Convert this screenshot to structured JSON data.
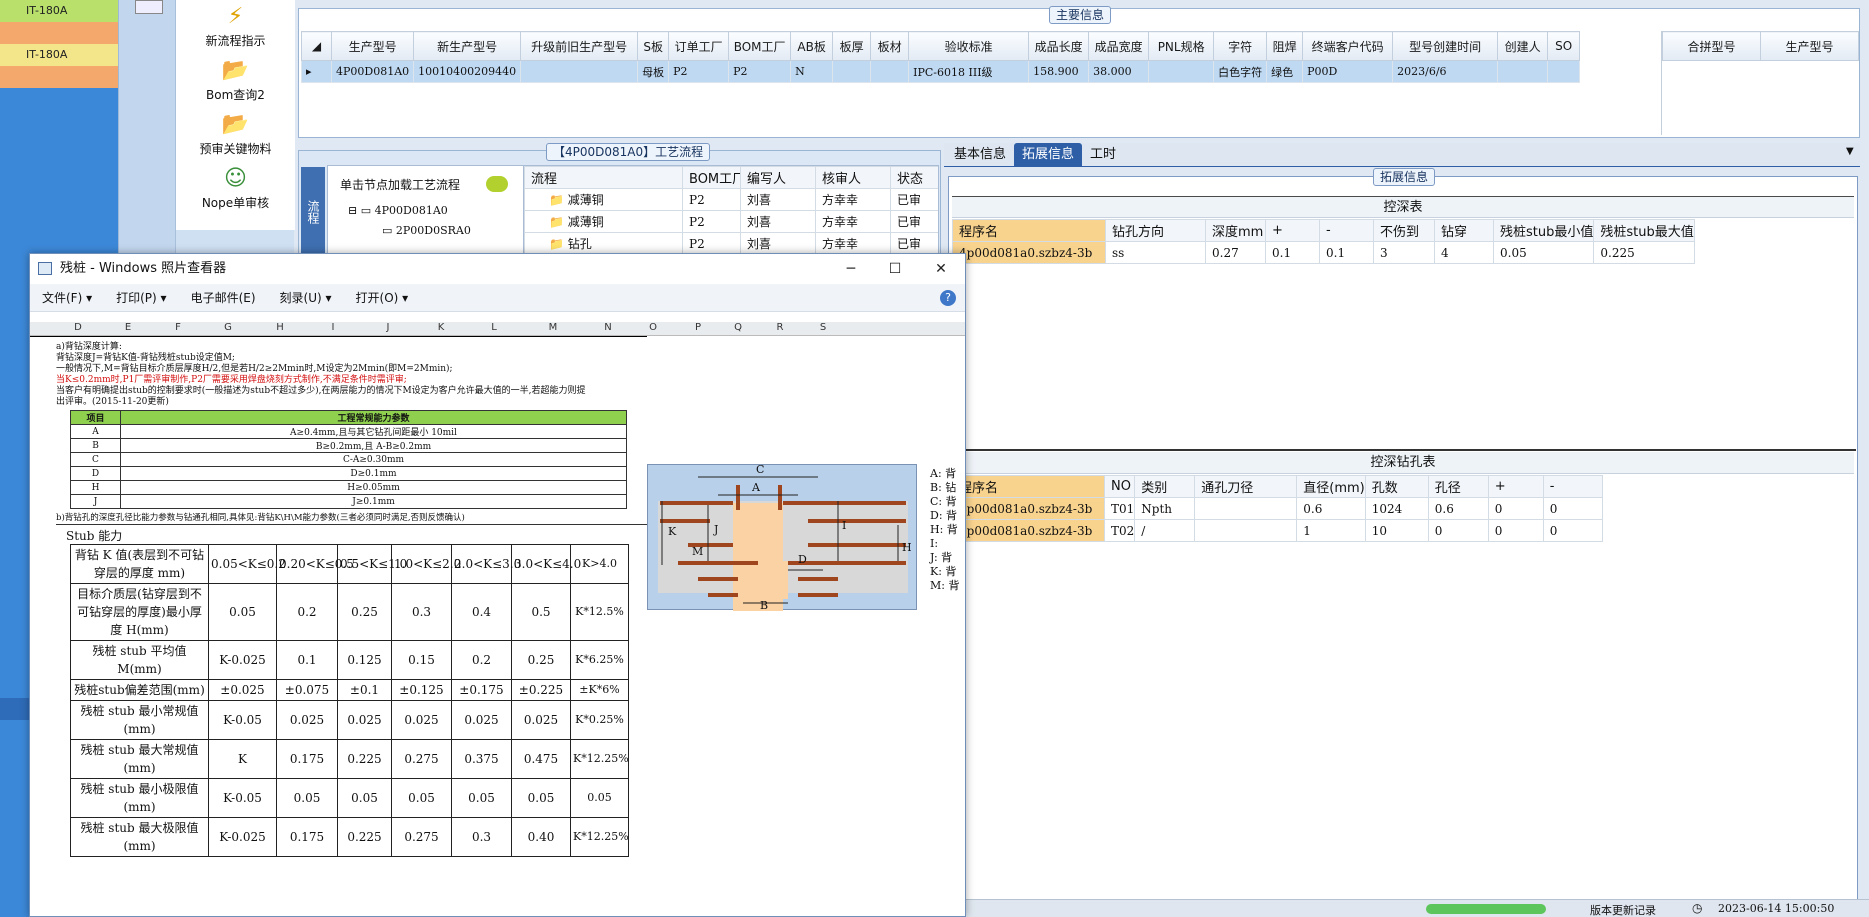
{
  "left_strip": {
    "rows": [
      "IT-180A",
      "",
      "IT-180A",
      ""
    ]
  },
  "sidebar": {
    "menu": [
      {
        "label": "新流程指示",
        "icon": "lightning-icon"
      },
      {
        "label": "Bom查询2",
        "icon": "folder-open-icon"
      },
      {
        "label": "预审关键物料",
        "icon": "folder-open-icon"
      },
      {
        "label": "Nope单审核",
        "icon": "user-icon"
      }
    ]
  },
  "main_info": {
    "title": "主要信息",
    "columns": [
      "生产型号",
      "新生产型号",
      "升级前旧生产型号",
      "S板",
      "订单工厂",
      "BOM工厂",
      "AB板",
      "板厚",
      "板材",
      "验收标准",
      "成品长度",
      "成品宽度",
      "PNL规格",
      "字符",
      "阻焊",
      "终端客户代码",
      "型号创建时间",
      "创建人",
      "SO"
    ],
    "row": [
      "4P00D081A0",
      "10010400209440",
      "",
      "母板",
      "P2",
      "P2",
      "N",
      "",
      "",
      "IPC-6018 III级",
      "158.900",
      "38.000",
      "",
      "白色字符",
      "绿色",
      "P00D",
      "2023/6/6",
      "",
      ""
    ],
    "side_columns": [
      "合拼型号",
      "生产型号"
    ]
  },
  "process": {
    "title": "【4P00D081A0】工艺流程",
    "vertical_tab": "流程",
    "load_hint": "单击节点加载工艺流程",
    "tree": [
      "4P00D081A0",
      "2P00D0SRA0"
    ],
    "columns": [
      "流程",
      "BOM工厂",
      "编写人",
      "核审人",
      "状态"
    ],
    "rows": [
      [
        "减薄铜",
        "P2",
        "刘喜",
        "方幸幸",
        "已审"
      ],
      [
        "减薄铜",
        "P2",
        "刘喜",
        "方幸幸",
        "已审"
      ],
      [
        "钻孔",
        "P2",
        "刘喜",
        "方幸幸",
        "已审"
      ]
    ]
  },
  "detail_tabs": [
    "基本信息",
    "拓展信息",
    "工时"
  ],
  "ext_info": {
    "title": "拓展信息",
    "depth_table": {
      "title": "控深表",
      "columns": [
        "程序名",
        "钻孔方向",
        "深度mm",
        "+",
        "-",
        "不伤到",
        "钻穿",
        "残桩stub最小值",
        "残桩stub最大值"
      ],
      "row": [
        "4p00d081a0.szbz4-3b",
        "ss",
        "0.27",
        "0.1",
        "0.1",
        "3",
        "4",
        "0.05",
        "0.225"
      ]
    },
    "hole_table": {
      "title": "控深钻孔表",
      "columns": [
        "程序名",
        "NO",
        "类别",
        "通孔刀径",
        "直径(mm)",
        "孔数",
        "孔径",
        "+",
        "-"
      ],
      "rows": [
        [
          "4p00d081a0.szbz4-3b",
          "T01",
          "Npth",
          "",
          "0.6",
          "1024",
          "0.6",
          "0",
          "0"
        ],
        [
          "4p00d081a0.szbz4-3b",
          "T02",
          "/",
          "",
          "1",
          "10",
          "0",
          "0",
          "0"
        ]
      ]
    }
  },
  "viewer": {
    "title": "残桩 - Windows 照片查看器",
    "menu": [
      "文件(F)",
      "打印(P)",
      "电子邮件(E)",
      "刻录(U)",
      "打开(O)"
    ],
    "col_headers": [
      "D",
      "E",
      "F",
      "G",
      "H",
      "I",
      "J",
      "K",
      "L",
      "M",
      "N",
      "O",
      "P",
      "Q",
      "R",
      "S"
    ],
    "notes": [
      "a)背钻深度计算:",
      "    背钻深度J=背钻K值-背钻残桩stub设定值M;",
      "一般情况下,M=背钻目标介质层厚度H/2,但是若H/2≥2Mmin时,M设定为2Mmin(即M=2Mmin);",
      "当K≤0.2mm时,P1厂需评审制作,P2厂需要采用焊盘烧刻方式制作,不满足条件时需评审;",
      "当客户有明确提出stub的控制要求时(一般描述为stub不超过多少),在两层能力的情况下M设定为客户允许最大值的一半,若超能力则提",
      "出评审。(2015-11-20更新)"
    ],
    "param_table": {
      "header": [
        "项目",
        "工程常规能力参数"
      ],
      "rows": [
        [
          "A",
          "A≥0.4mm,且与其它钻孔间距最小 10mil"
        ],
        [
          "B",
          "B≥0.2mm,且 A-B≥0.2mm"
        ],
        [
          "C",
          "C-A≥0.30mm"
        ],
        [
          "D",
          "D≥0.1mm"
        ],
        [
          "H",
          "H≥0.05mm"
        ],
        [
          "J",
          "J≥0.1mm"
        ]
      ]
    },
    "note_b": "b)背钻孔的深度孔径比能力参数与钻通孔相同,具体见:背钻K\\H\\M能力参数(三者必须同时满足,否则反馈确认)",
    "stub_title": "Stub 能力",
    "stub_table": [
      [
        "背钻 K 值(表层到不可钻穿层的厚度 mm)",
        "0.05<K≤0.2",
        "0.20<K≤0.5",
        "0.5<K≤1.0",
        "1.0<K≤2.0",
        "2.0<K≤3.0",
        "3.0<K≤4.0",
        "K>4.0"
      ],
      [
        "目标介质层(钻穿层到不可钻穿层的厚度)最小厚度 H(mm)",
        "0.05",
        "0.2",
        "0.25",
        "0.3",
        "0.4",
        "0.5",
        "K*12.5%"
      ],
      [
        "残桩 stub 平均值 M(mm)",
        "K-0.025",
        "0.1",
        "0.125",
        "0.15",
        "0.2",
        "0.25",
        "K*6.25%"
      ],
      [
        "残桩stub偏差范围(mm)",
        "±0.025",
        "±0.075",
        "±0.1",
        "±0.125",
        "±0.175",
        "±0.225",
        "±K*6%"
      ],
      [
        "残桩 stub 最小常规值(mm)",
        "K-0.05",
        "0.025",
        "0.025",
        "0.025",
        "0.025",
        "0.025",
        "K*0.25%"
      ],
      [
        "残桩 stub 最大常规值(mm)",
        "K",
        "0.175",
        "0.225",
        "0.275",
        "0.375",
        "0.475",
        "K*12.25%"
      ],
      [
        "残桩 stub 最小极限值(mm)",
        "K-0.05",
        "0.05",
        "0.05",
        "0.05",
        "0.05",
        "0.05",
        "0.05"
      ],
      [
        "残桩 stub 最大极限值(mm)",
        "K-0.025",
        "0.175",
        "0.225",
        "0.275",
        "0.3",
        "0.40",
        "K*12.25%"
      ]
    ],
    "legend": [
      "A:",
      "B:",
      "C:",
      "D:",
      "H:",
      "I:",
      "J:",
      "K:",
      "M:"
    ],
    "legend_suffix": [
      "背",
      "钻",
      "背",
      "背",
      "背",
      "",
      "背",
      "背",
      "背"
    ],
    "diagram_labels": [
      "C",
      "A",
      "K",
      "J",
      "I",
      "H",
      "M",
      "D",
      "B"
    ]
  },
  "status": {
    "text": "版本更新记录",
    "time": "2023-06-14 15:00:50"
  }
}
